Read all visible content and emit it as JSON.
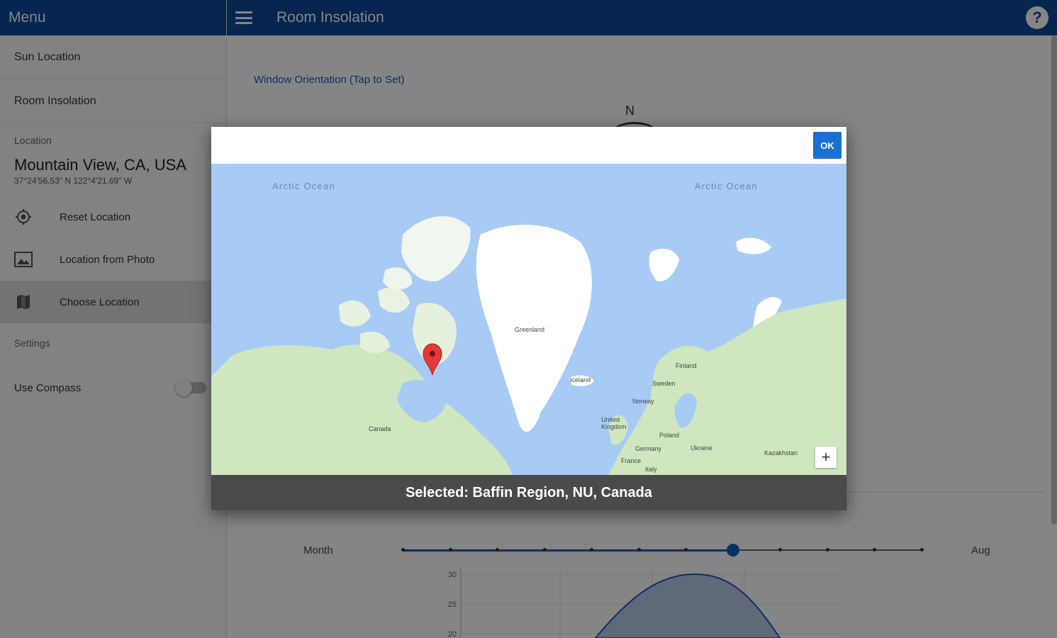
{
  "sidebar": {
    "header": "Menu",
    "nav": [
      "Sun Location",
      "Room Insolation"
    ],
    "location_label": "Location",
    "location_name": "Mountain View, CA, USA",
    "location_coords": "37°24'56.53\" N 122°4'21.69\" W",
    "actions": [
      {
        "label": "Reset Location",
        "icon": "crosshair-icon"
      },
      {
        "label": "Location from Photo",
        "icon": "photo-icon"
      },
      {
        "label": "Choose Location",
        "icon": "map-icon"
      }
    ],
    "settings_label": "Settings",
    "compass_label": "Use Compass",
    "compass_on": false
  },
  "header": {
    "title": "Room Insolation",
    "help": "?"
  },
  "main": {
    "orientation_link": "Window Orientation (Tap to Set)",
    "compass_north": "N",
    "month_label": "Month",
    "month_value": "Aug",
    "slider_ticks": 12,
    "slider_selected_index": 7
  },
  "chart_data": {
    "type": "area",
    "y_ticks": [
      "30",
      "25",
      "20"
    ],
    "ylim": [
      20,
      30
    ]
  },
  "dialog": {
    "ok_label": "OK",
    "ocean_labels": [
      "Arctic Ocean",
      "Arctic Ocean"
    ],
    "country_labels": [
      "Greenland",
      "Iceland",
      "Canada",
      "Finland",
      "Sweden",
      "Norway",
      "United Kingdom",
      "Poland",
      "Ukraine",
      "Germany",
      "France",
      "Italy",
      "Kazakhstan"
    ],
    "zoom_in": "+",
    "selection_text": "Selected: Baffin Region, NU, Canada"
  },
  "colors": {
    "header_blue": "#0d4a9a",
    "accent_blue": "#1a6fd1",
    "water": "#a7cbf5",
    "land_green": "#cfe6bf",
    "ice": "#ffffff",
    "pin_red": "#e53935"
  }
}
